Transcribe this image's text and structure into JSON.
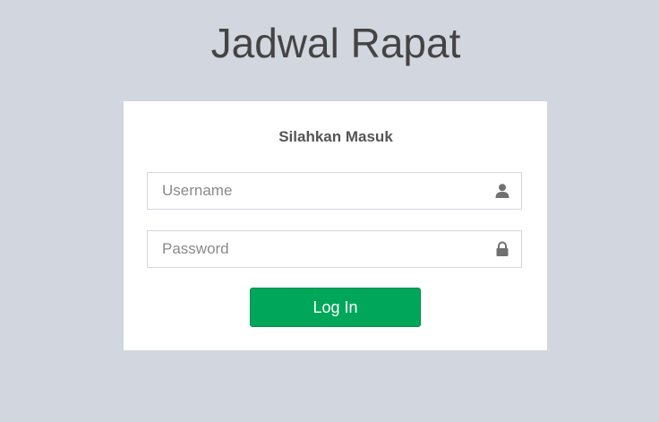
{
  "app": {
    "title": "Jadwal Rapat"
  },
  "login": {
    "heading": "Silahkan Masuk",
    "username": {
      "value": "",
      "placeholder": "Username",
      "icon": "user-icon"
    },
    "password": {
      "value": "",
      "placeholder": "Password",
      "icon": "lock-icon"
    },
    "submit_label": "Log In"
  },
  "colors": {
    "background": "#d2d6de",
    "card": "#ffffff",
    "accent": "#00a65a",
    "title_text": "#444444"
  }
}
